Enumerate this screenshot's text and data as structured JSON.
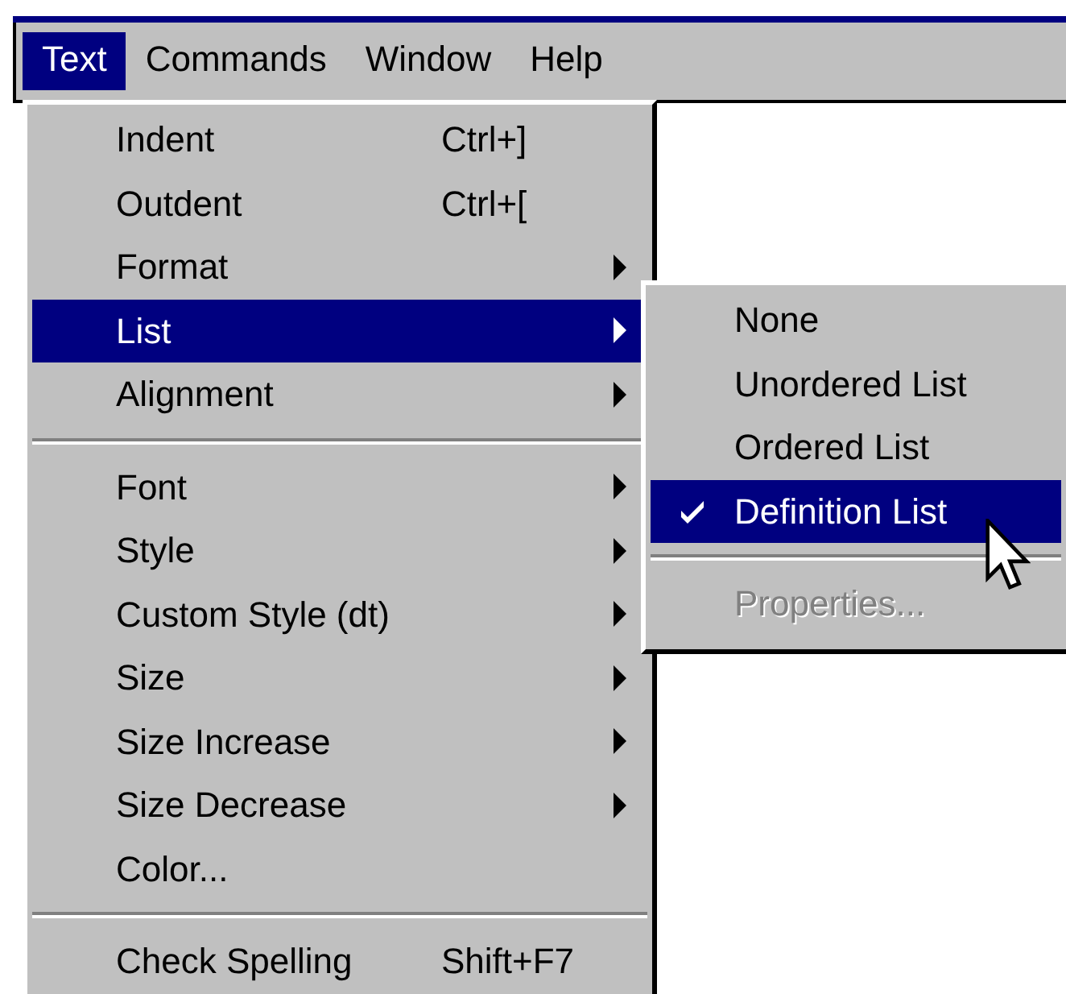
{
  "menubar": [
    {
      "label": "Text",
      "selected": true
    },
    {
      "label": "Commands",
      "selected": false
    },
    {
      "label": "Window",
      "selected": false
    },
    {
      "label": "Help",
      "selected": false
    }
  ],
  "menu": {
    "items": [
      {
        "kind": "command",
        "label": "Indent",
        "shortcut": "Ctrl+]",
        "selected": false
      },
      {
        "kind": "command",
        "label": "Outdent",
        "shortcut": "Ctrl+[",
        "selected": false
      },
      {
        "kind": "submenu",
        "label": "Format",
        "selected": false
      },
      {
        "kind": "submenu",
        "label": "List",
        "selected": true
      },
      {
        "kind": "submenu",
        "label": "Alignment",
        "selected": false
      },
      {
        "kind": "separator"
      },
      {
        "kind": "submenu",
        "label": "Font",
        "selected": false
      },
      {
        "kind": "submenu",
        "label": "Style",
        "selected": false
      },
      {
        "kind": "submenu",
        "label": "Custom Style (dt)",
        "selected": false
      },
      {
        "kind": "submenu",
        "label": "Size",
        "selected": false
      },
      {
        "kind": "submenu",
        "label": "Size Increase",
        "selected": false
      },
      {
        "kind": "submenu",
        "label": "Size Decrease",
        "selected": false
      },
      {
        "kind": "command",
        "label": "Color...",
        "selected": false
      },
      {
        "kind": "separator"
      },
      {
        "kind": "command",
        "label": "Check Spelling",
        "shortcut": "Shift+F7",
        "selected": false
      }
    ]
  },
  "submenu": {
    "items": [
      {
        "kind": "command",
        "label": "None",
        "checked": false,
        "selected": false,
        "disabled": false
      },
      {
        "kind": "command",
        "label": "Unordered List",
        "checked": false,
        "selected": false,
        "disabled": false
      },
      {
        "kind": "command",
        "label": "Ordered List",
        "checked": false,
        "selected": false,
        "disabled": false
      },
      {
        "kind": "command",
        "label": "Definition List",
        "checked": true,
        "selected": true,
        "disabled": false
      },
      {
        "kind": "separator"
      },
      {
        "kind": "command",
        "label": "Properties...",
        "checked": false,
        "selected": false,
        "disabled": true
      }
    ]
  }
}
